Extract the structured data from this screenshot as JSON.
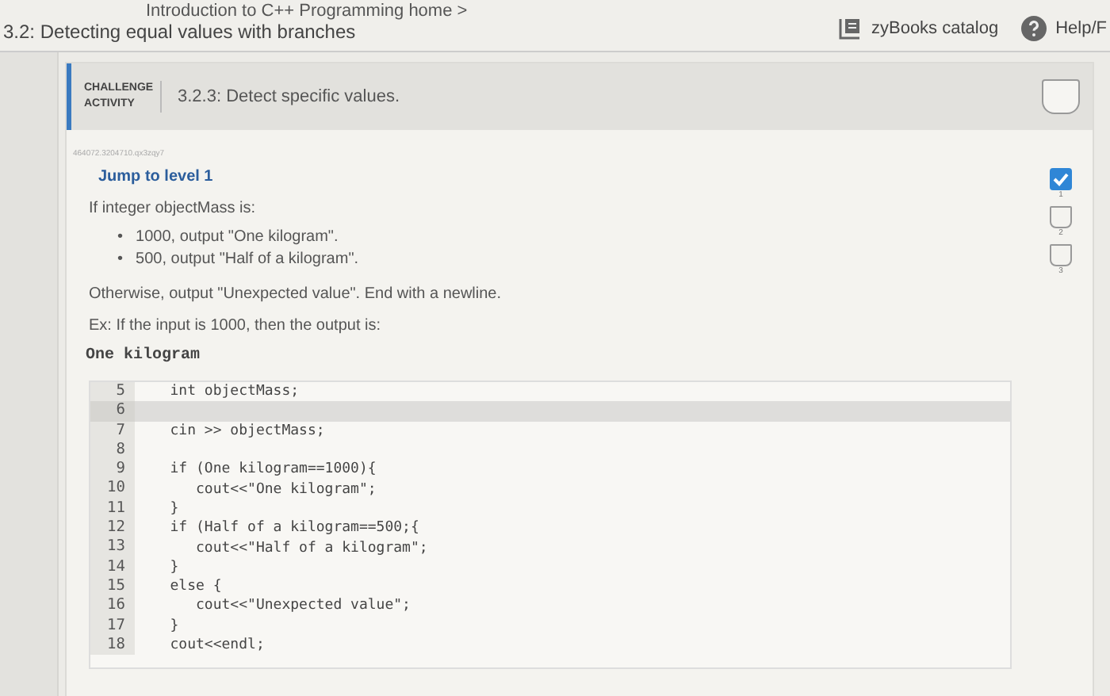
{
  "breadcrumb": "Introduction to C++ Programming home >",
  "section_title": "3.2: Detecting equal values with branches",
  "top_links": [
    {
      "kind": "catalog",
      "label": "zyBooks catalog"
    },
    {
      "kind": "help",
      "label": "Help/F"
    }
  ],
  "activity": {
    "badge": "CHALLENGE ACTIVITY",
    "title": "3.2.3: Detect specific values.",
    "completed": false
  },
  "activity_id": "464072.3204710.qx3zqy7",
  "jump_link": "Jump to level 1",
  "levels": [
    {
      "label": "1",
      "checked": true
    },
    {
      "label": "2",
      "checked": false
    },
    {
      "label": "3",
      "checked": false
    }
  ],
  "intro": "If integer objectMass is:",
  "bullets": [
    {
      "marker": "•",
      "text": "1000, output \"One kilogram\"."
    },
    {
      "marker": "•",
      "text": "500, output \"Half of a kilogram\"."
    }
  ],
  "otherwise": "Otherwise, output \"Unexpected value\". End with a newline.",
  "example": "Ex: If the input is 1000, then the output is:",
  "example_output": "One kilogram",
  "code_lines": [
    {
      "num": "5",
      "text": "   int objectMass;",
      "selected": false
    },
    {
      "num": "6",
      "selected": true
    },
    {
      "num": "7",
      "text": "   cin >> objectMass;",
      "selected": false
    },
    {
      "num": "8",
      "selected": false
    },
    {
      "num": "9",
      "text": "   if (One kilogram==1000){",
      "selected": false
    },
    {
      "num": "10",
      "text": "      cout<<\"One kilogram\";",
      "selected": false
    },
    {
      "num": "11",
      "text": "   }",
      "selected": false
    },
    {
      "num": "12",
      "text": "   if (Half of a kilogram==500;{",
      "selected": false
    },
    {
      "num": "13",
      "text": "      cout<<\"Half of a kilogram\";",
      "selected": false
    },
    {
      "num": "14",
      "text": "   }",
      "selected": false
    },
    {
      "num": "15",
      "text": "   else {",
      "selected": false
    },
    {
      "num": "16",
      "text": "      cout<<\"Unexpected value\";",
      "selected": false
    },
    {
      "num": "17",
      "text": "   }",
      "selected": false
    },
    {
      "num": "18",
      "text": "   cout<<endl;",
      "selected": false
    }
  ]
}
